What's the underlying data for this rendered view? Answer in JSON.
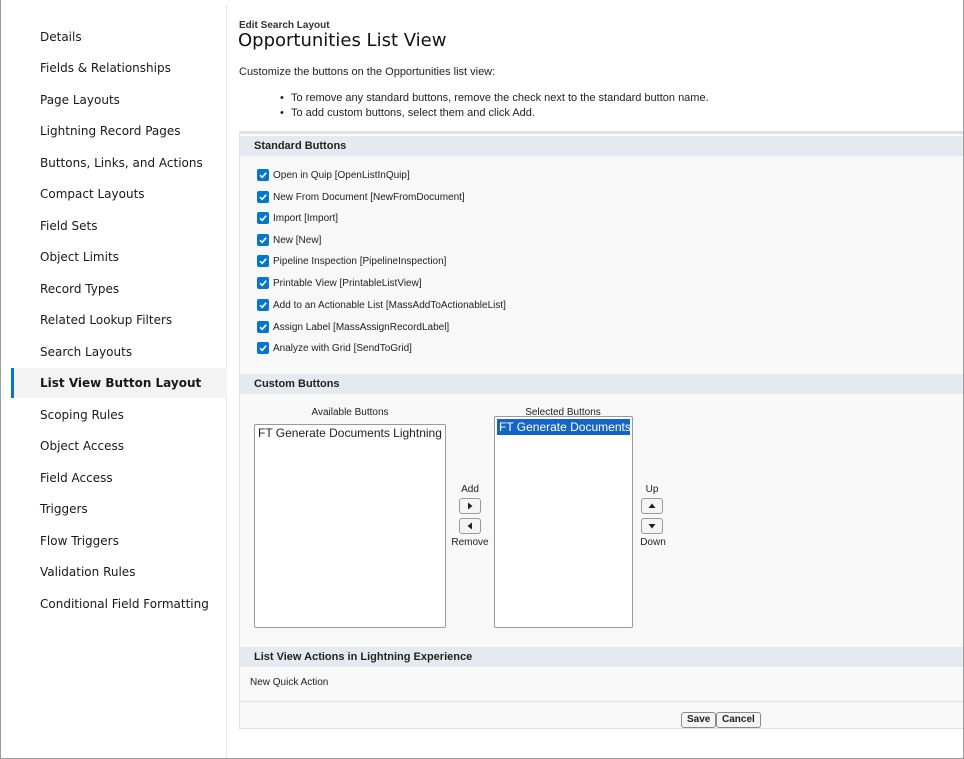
{
  "sidebar": {
    "items": [
      {
        "label": "Details"
      },
      {
        "label": "Fields & Relationships"
      },
      {
        "label": "Page Layouts"
      },
      {
        "label": "Lightning Record Pages"
      },
      {
        "label": "Buttons, Links, and Actions"
      },
      {
        "label": "Compact Layouts"
      },
      {
        "label": "Field Sets"
      },
      {
        "label": "Object Limits"
      },
      {
        "label": "Record Types"
      },
      {
        "label": "Related Lookup Filters"
      },
      {
        "label": "Search Layouts"
      },
      {
        "label": "List View Button Layout"
      },
      {
        "label": "Scoping Rules"
      },
      {
        "label": "Object Access"
      },
      {
        "label": "Field Access"
      },
      {
        "label": "Triggers"
      },
      {
        "label": "Flow Triggers"
      },
      {
        "label": "Validation Rules"
      },
      {
        "label": "Conditional Field Formatting"
      }
    ],
    "active_index": 11
  },
  "header": {
    "subtitle": "Edit Search Layout",
    "title": "Opportunities List View"
  },
  "intro": "Customize the buttons on the Opportunities list view:",
  "bullets": [
    "To remove any standard buttons, remove the check next to the standard button name.",
    "To add custom buttons, select them and click Add."
  ],
  "standard": {
    "heading": "Standard Buttons",
    "buttons": [
      {
        "label": "Open in Quip [OpenListInQuip]",
        "checked": true
      },
      {
        "label": "New From Document [NewFromDocument]",
        "checked": true
      },
      {
        "label": "Import [Import]",
        "checked": true
      },
      {
        "label": "New [New]",
        "checked": true
      },
      {
        "label": "Pipeline Inspection [PipelineInspection]",
        "checked": true
      },
      {
        "label": "Printable View [PrintableListView]",
        "checked": true
      },
      {
        "label": "Add to an Actionable List [MassAddToActionableList]",
        "checked": true
      },
      {
        "label": "Assign Label [MassAssignRecordLabel]",
        "checked": true
      },
      {
        "label": "Analyze with Grid [SendToGrid]",
        "checked": true
      }
    ]
  },
  "custom": {
    "heading": "Custom Buttons",
    "available_label": "Available Buttons",
    "selected_label": "Selected Buttons",
    "available": [
      "FT Generate Documents Lightning"
    ],
    "selected": [
      "FT Generate Documents"
    ],
    "add_label": "Add",
    "remove_label": "Remove",
    "up_label": "Up",
    "down_label": "Down"
  },
  "list_actions": {
    "heading": "List View Actions in Lightning Experience",
    "text": "New Quick Action"
  },
  "footer": {
    "save_label": "Save",
    "cancel_label": "Cancel"
  },
  "colors": {
    "accent": "#0176d3",
    "selected_option": "#1565c8",
    "section_header": "#e5eaf0"
  }
}
